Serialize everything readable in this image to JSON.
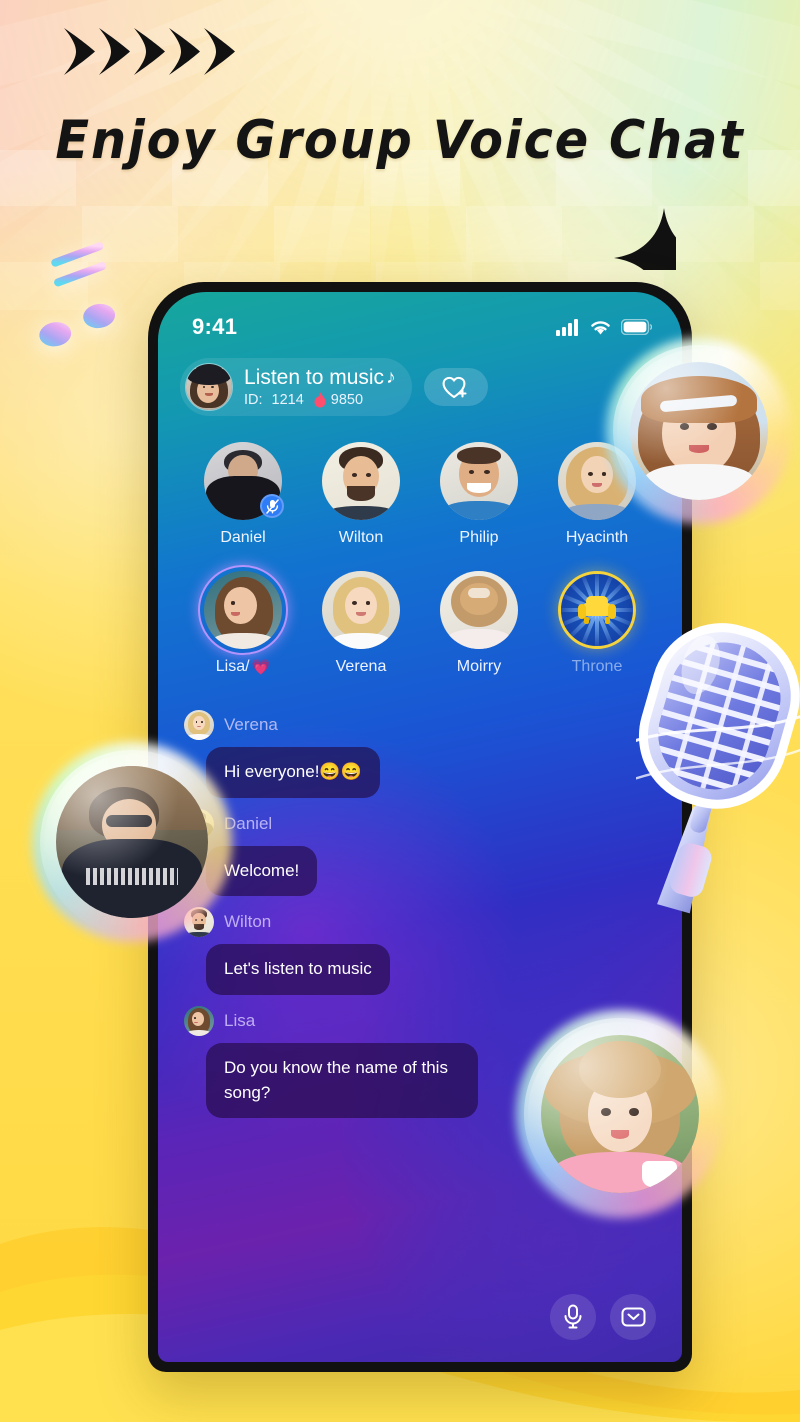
{
  "promo": {
    "headline": "Enjoy Group Voice Chat",
    "arrow_count": 5,
    "accent_yellow": "#ffe05c",
    "accent_peach": "#fbd2bf",
    "accent_mint": "#d7f2d0"
  },
  "phone": {
    "status_bar": {
      "time": "9:41",
      "signal_icon": "signal-bars-icon",
      "wifi_icon": "wifi-icon",
      "battery_icon": "battery-icon"
    },
    "room_header": {
      "host_avatar": "host-avatar",
      "title": "Listen to music",
      "title_note_icon": "music-note-emoji",
      "id_label": "ID:",
      "id_value": "1214",
      "hot_icon": "fire-emoji",
      "hot_value": "9850",
      "follow_icon": "heart-plus-icon"
    },
    "seats": [
      {
        "name": "Daniel",
        "muted": true,
        "speaking": false,
        "type": "user"
      },
      {
        "name": "Wilton",
        "muted": false,
        "speaking": false,
        "type": "user"
      },
      {
        "name": "Philip",
        "muted": false,
        "speaking": false,
        "type": "user"
      },
      {
        "name": "Hyacinth",
        "muted": false,
        "speaking": false,
        "type": "user"
      },
      {
        "name": "Lisa/",
        "name_suffix_icon": "pink-heart-emoji",
        "muted": false,
        "speaking": true,
        "type": "user"
      },
      {
        "name": "Verena",
        "muted": false,
        "speaking": false,
        "type": "user"
      },
      {
        "name": "Moirry",
        "muted": false,
        "speaking": false,
        "type": "user"
      },
      {
        "name": "Throne",
        "muted": false,
        "speaking": false,
        "type": "throne",
        "icon": "armchair-icon"
      }
    ],
    "chat": [
      {
        "sender": "Verena",
        "text": "Hi everyone!😄😄"
      },
      {
        "sender": "Daniel",
        "text": "Welcome!"
      },
      {
        "sender": "Wilton",
        "text": "Let's listen to music"
      },
      {
        "sender": "Lisa",
        "text": "Do you know the name of this song?"
      }
    ],
    "bottom_bar": {
      "mic_icon": "microphone-icon",
      "message_icon": "message-envelope-icon"
    }
  },
  "decorations": {
    "music_note_icon": "music-note-icon",
    "microphone_icon": "retro-microphone-icon",
    "sparkle_icon": "four-point-star-icon",
    "floating_bubbles": [
      {
        "id": "bubble-top-right"
      },
      {
        "id": "bubble-left"
      },
      {
        "id": "bubble-bottom-right"
      }
    ]
  }
}
